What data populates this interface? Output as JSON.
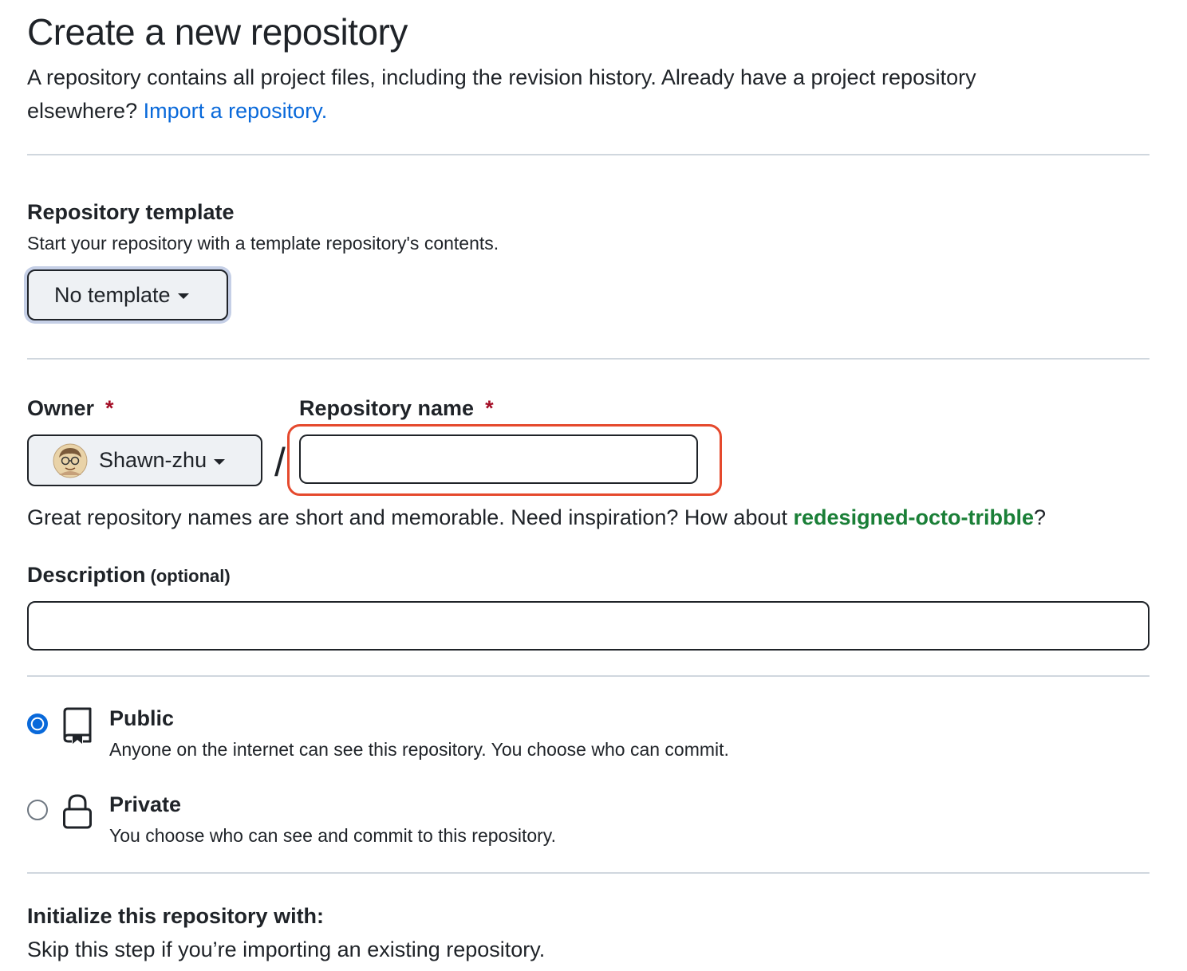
{
  "header": {
    "title": "Create a new repository",
    "subtitle": "A repository contains all project files, including the revision history. Already have a project repository elsewhere?",
    "import_link": "Import a repository."
  },
  "template": {
    "heading": "Repository template",
    "description": "Start your repository with a template repository's contents.",
    "button_label": "No template",
    "button_icon": "triangle-down-icon"
  },
  "owner": {
    "label": "Owner",
    "required_mark": "*",
    "value": "Shawn-zhu",
    "avatar_icon": "avatar"
  },
  "separator": "/",
  "repo_name": {
    "label": "Repository name",
    "required_mark": "*",
    "value": "",
    "highlight_color": "#e5492d"
  },
  "name_hint": {
    "prefix": "Great repository names are short and memorable. Need inspiration? How about",
    "suggestion": "redesigned-octo-tribble",
    "suffix": "?"
  },
  "description_field": {
    "label": "Description",
    "optional": "(optional)",
    "value": ""
  },
  "visibility": {
    "selected": "public",
    "options": [
      {
        "id": "public",
        "title": "Public",
        "description": "Anyone on the internet can see this repository. You choose who can commit.",
        "icon": "repo-icon"
      },
      {
        "id": "private",
        "title": "Private",
        "description": "You choose who can see and commit to this repository.",
        "icon": "lock-icon"
      }
    ]
  },
  "initialize": {
    "heading": "Initialize this repository with:",
    "description": "Skip this step if you’re importing an existing repository."
  },
  "colors": {
    "link": "#0969da",
    "suggestion": "#1a7f37",
    "required": "#a40e26",
    "radio_selected": "#0969da",
    "divider": "#d0d7de"
  }
}
